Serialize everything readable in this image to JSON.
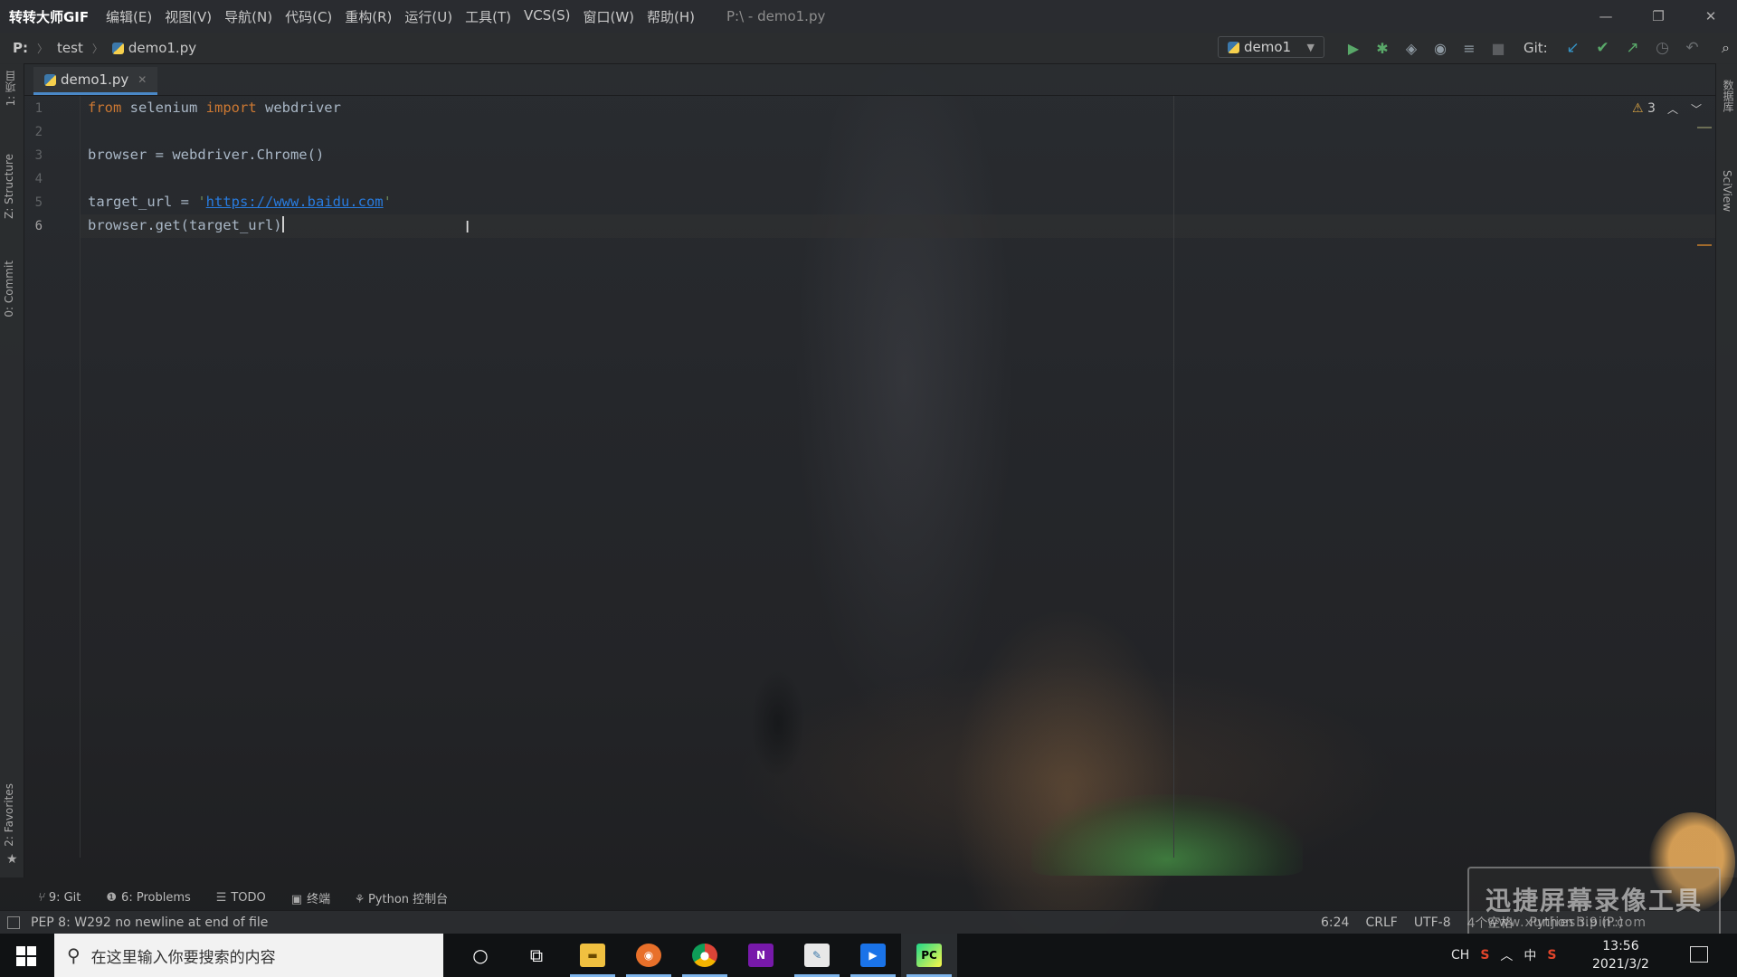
{
  "titlebar": {
    "brand": "转转大师GIF",
    "menu": [
      "编辑(E)",
      "视图(V)",
      "导航(N)",
      "代码(C)",
      "重构(R)",
      "运行(U)",
      "工具(T)",
      "VCS(S)",
      "窗口(W)",
      "帮助(H)"
    ],
    "title": "P:\\ - demo1.py"
  },
  "toolbar": {
    "breadcrumb": [
      "P:",
      "test",
      "demo1.py"
    ],
    "run_config": "demo1",
    "git_label": "Git:"
  },
  "left_strip": {
    "project": "1: 项目",
    "structure": "Z: Structure",
    "commit": "0: Commit",
    "favorites": "2: Favorites"
  },
  "right_strip": {
    "database": "数据库",
    "sciview": "SciView"
  },
  "tab": {
    "label": "demo1.py"
  },
  "editor": {
    "line_numbers": [
      "1",
      "2",
      "3",
      "4",
      "5",
      "6"
    ],
    "current_line": 6,
    "lines": {
      "l1_kw1": "from",
      "l1_mod": " selenium ",
      "l1_kw2": "import",
      "l1_rest": " webdriver",
      "l3": "browser = webdriver.Chrome()",
      "l5_pre": "target_url = ",
      "l5_q1": "'",
      "l5_url": "https://www.baidu.com",
      "l5_q2": "'",
      "l6": "browser.get(target_url)"
    },
    "warning_count": "3"
  },
  "tool_windows": {
    "git": "9: Git",
    "problems": "6: Problems",
    "todo": "TODO",
    "terminal": "终端",
    "python_console": "Python 控制台"
  },
  "statusbar": {
    "message": "PEP 8: W292 no newline at end of file",
    "position": "6:24",
    "line_sep": "CRLF",
    "encoding": "UTF-8",
    "indent": "4个空格",
    "interpreter": "Python 3.9 (P:)"
  },
  "taskbar": {
    "search_placeholder": "在这里输入你要搜索的内容",
    "tray_lang": "CH",
    "tray_ime": "中",
    "time": "13:56",
    "date": "2021/3/2"
  },
  "watermark": {
    "title": "迅捷屏幕录像工具",
    "url": "www.xunjieshipin.com"
  },
  "colors": {
    "keyword": "#cc7832",
    "string": "#6a8759",
    "url": "#287bde",
    "default_code": "#a9b7c6",
    "run_green": "#59a869",
    "git_blue": "#3592c4"
  }
}
